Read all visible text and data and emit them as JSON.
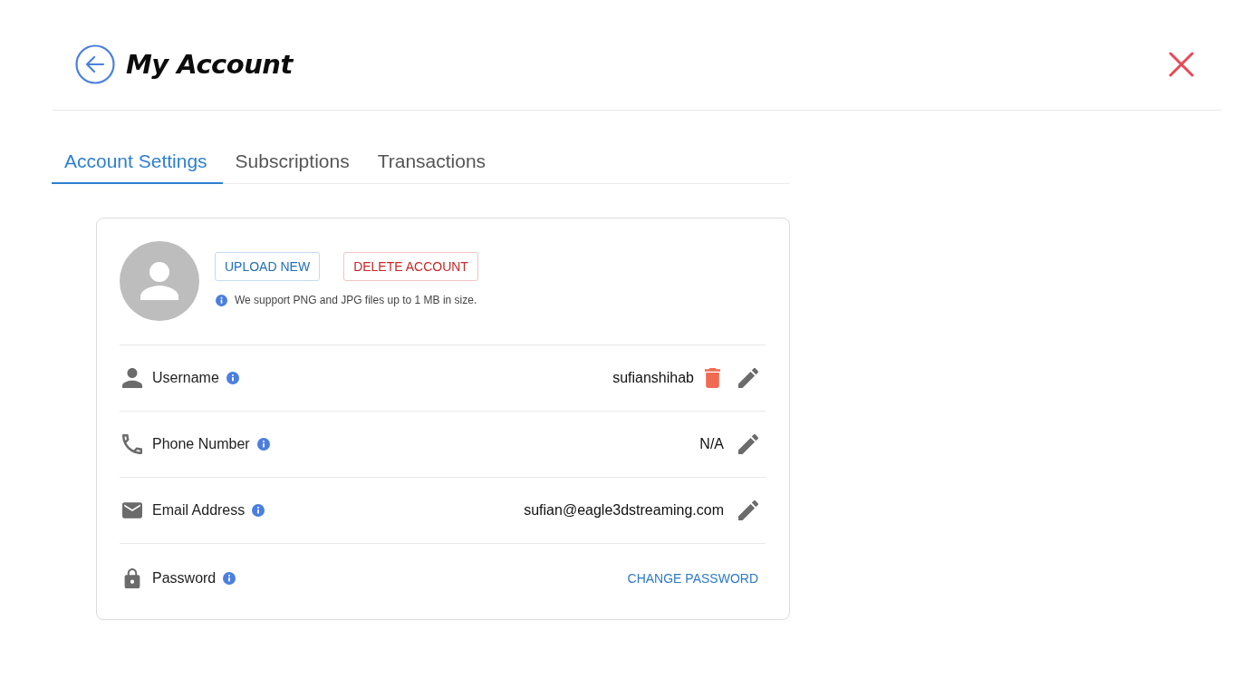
{
  "header": {
    "title": "My Account"
  },
  "tabs": [
    {
      "label": "Account Settings",
      "selected": true
    },
    {
      "label": "Subscriptions",
      "selected": false
    },
    {
      "label": "Transactions",
      "selected": false
    }
  ],
  "profile": {
    "buttons": [
      {
        "label": "UPLOAD NEW",
        "kind": "primary"
      },
      {
        "label": "DELETE ACCOUNT",
        "kind": "danger"
      }
    ],
    "note": "We support PNG and JPG files up to 1 MB in size."
  },
  "fields": [
    {
      "kind": "user",
      "label": "Username",
      "value": "sufianshihab",
      "deletable": true,
      "editable": true
    },
    {
      "kind": "phone",
      "label": "Phone Number",
      "value": "N/A",
      "editable": true
    },
    {
      "kind": "email",
      "label": "Email Address",
      "value": "sufian@eagle3dstreaming.com",
      "editable": true
    },
    {
      "kind": "lock",
      "label": "Password",
      "action": "CHANGE PASSWORD"
    }
  ]
}
